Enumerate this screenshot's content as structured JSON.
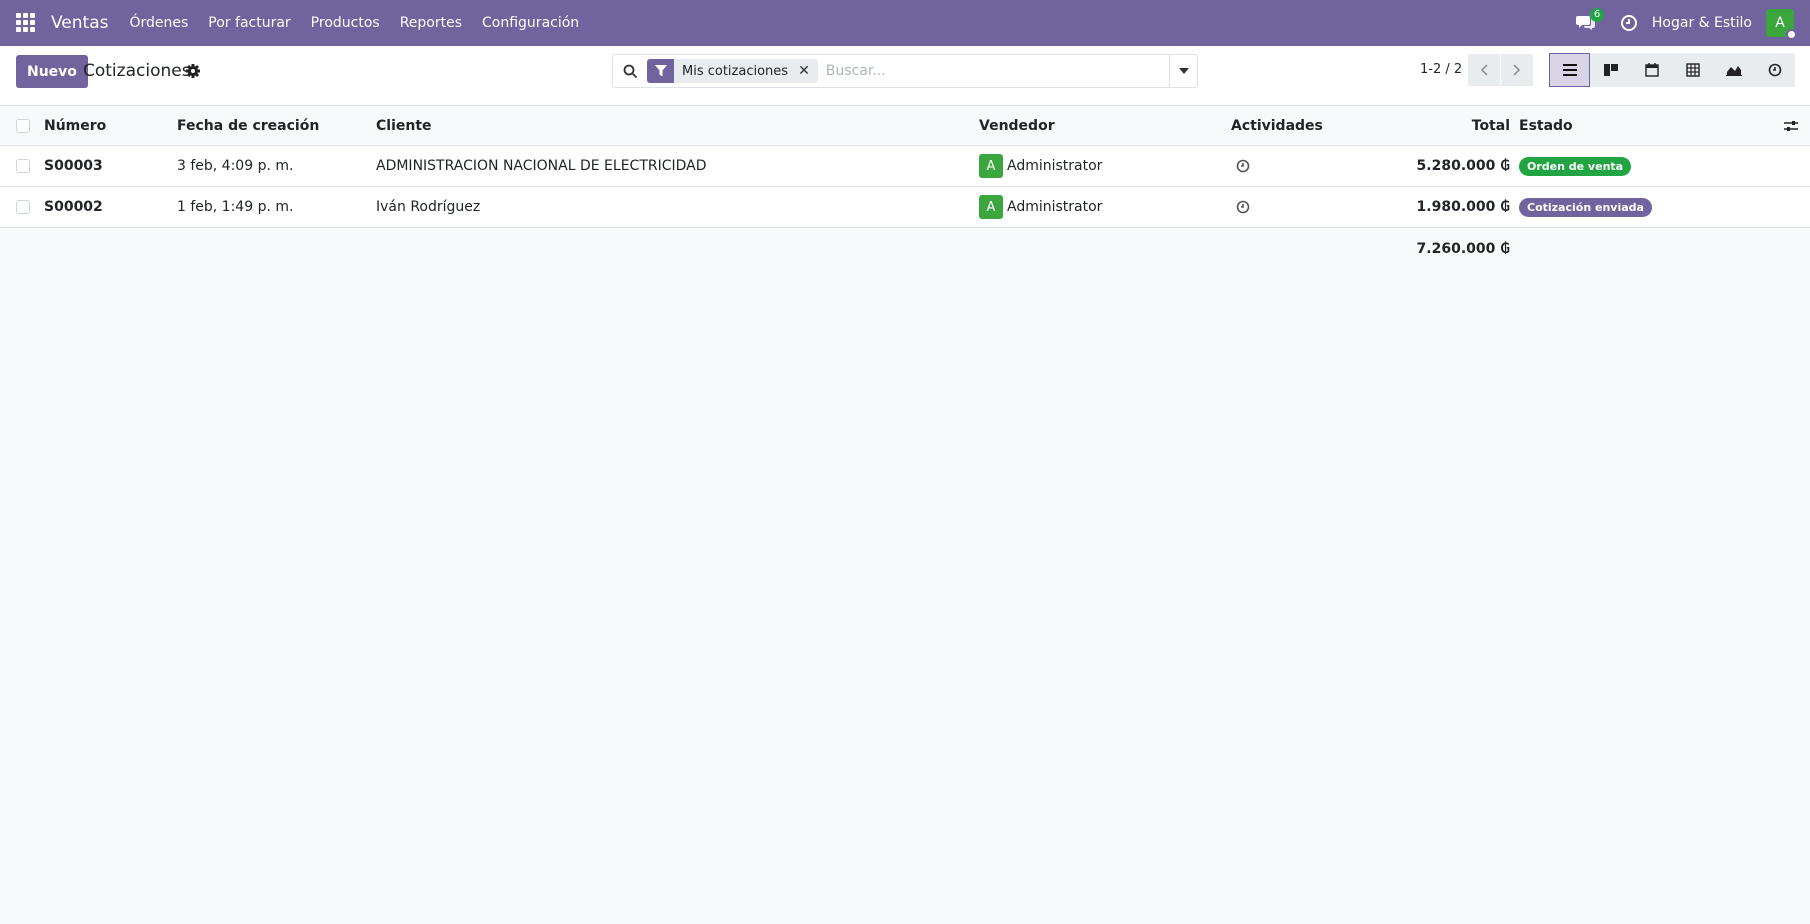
{
  "navbar": {
    "app_name": "Ventas",
    "menu": [
      "Órdenes",
      "Por facturar",
      "Productos",
      "Reportes",
      "Configuración"
    ],
    "chat_count": "6",
    "company": "Hogar & Estilo",
    "user_initial": "A"
  },
  "control": {
    "new_button": "Nuevo",
    "title": "Cotizaciones",
    "facet": "Mis cotizaciones",
    "search_placeholder": "Buscar...",
    "pager": "1-2 / 2"
  },
  "table": {
    "headers": {
      "number": "Número",
      "date": "Fecha de creación",
      "customer": "Cliente",
      "salesperson": "Vendedor",
      "activities": "Actividades",
      "total": "Total",
      "status": "Estado"
    },
    "rows": [
      {
        "number": "S00003",
        "date": "3 feb, 4:09 p. m.",
        "customer": "ADMINISTRACION NACIONAL DE ELECTRICIDAD",
        "salesperson_initial": "A",
        "salesperson": "Administrator",
        "total": "5.280.000 ₲",
        "status": "Orden de venta",
        "status_color": "#21a543"
      },
      {
        "number": "S00002",
        "date": "1 feb, 1:49 p. m.",
        "customer": "Iván Rodríguez",
        "salesperson_initial": "A",
        "salesperson": "Administrator",
        "total": "1.980.000 ₲",
        "status": "Cotización enviada",
        "status_color": "#71639e"
      }
    ],
    "grand_total": "7.260.000 ₲"
  },
  "colors": {
    "brand": "#71639e",
    "success": "#21a543",
    "avatar": "#3aa63d"
  }
}
